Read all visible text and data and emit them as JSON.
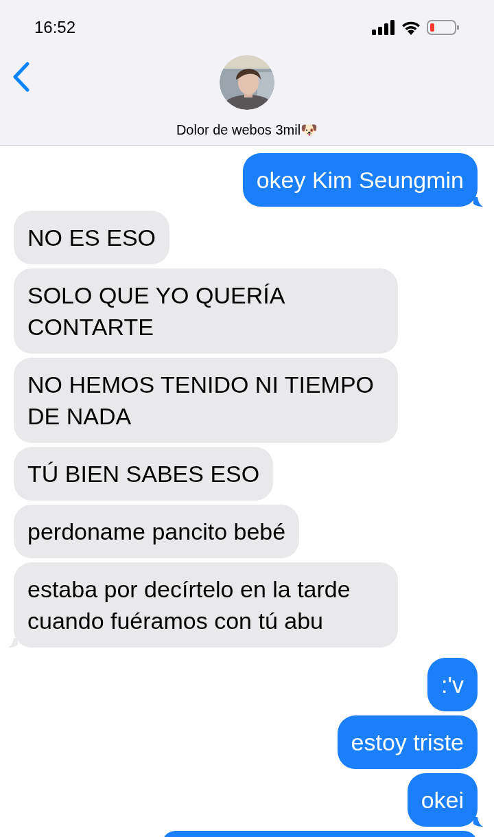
{
  "status_bar": {
    "time": "16:52"
  },
  "header": {
    "contact_name": "Dolor de webos 3mil🐶"
  },
  "messages": [
    {
      "kind": "sent",
      "text": "okey Kim Seungmin"
    },
    {
      "kind": "received",
      "text": "NO ES ESO"
    },
    {
      "kind": "received",
      "text": "SOLO QUE YO QUERÍA CONTARTE"
    },
    {
      "kind": "received",
      "text": "NO HEMOS TENIDO NI TIEMPO DE NADA"
    },
    {
      "kind": "received",
      "text": "TÚ BIEN SABES ESO"
    },
    {
      "kind": "received",
      "text": "perdoname pancito bebé"
    },
    {
      "kind": "received",
      "text": "estaba por decírtelo en la tarde cuando fuéramos con tú abu"
    },
    {
      "kind": "sent",
      "text": ":'v"
    },
    {
      "kind": "sent",
      "text": "estoy triste"
    },
    {
      "kind": "sent",
      "text": "okei"
    },
    {
      "kind": "clipped"
    }
  ]
}
